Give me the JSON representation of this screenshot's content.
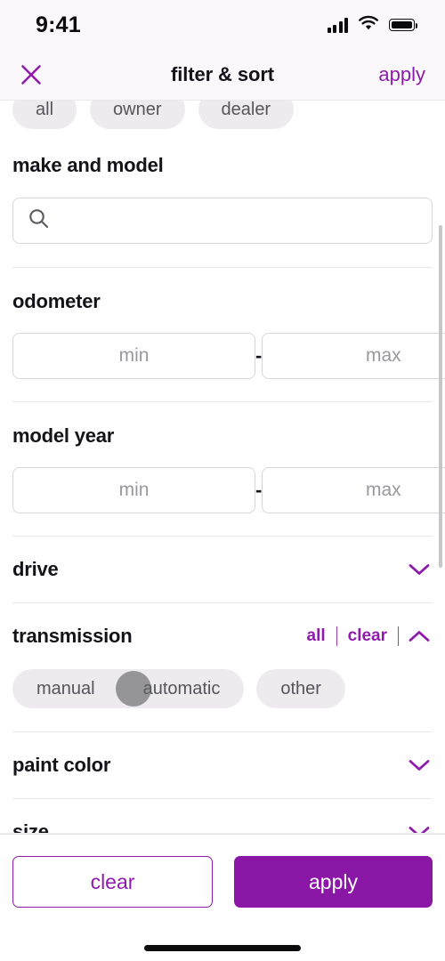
{
  "status_bar": {
    "time": "9:41",
    "cellular_icon": "signal-bars-icon",
    "wifi_icon": "wifi-icon",
    "battery_icon": "battery-full-icon"
  },
  "header": {
    "close_icon": "close-icon",
    "title": "filter & sort",
    "apply_label": "apply"
  },
  "seller_chips": [
    {
      "label": "all"
    },
    {
      "label": "owner"
    },
    {
      "label": "dealer"
    }
  ],
  "sections": {
    "make_and_model": {
      "title": "make and model",
      "search_icon": "search-icon",
      "search_value": "",
      "search_placeholder": ""
    },
    "odometer": {
      "title": "odometer",
      "min_value": "",
      "min_placeholder": "min",
      "max_value": "",
      "max_placeholder": "max",
      "separator": "-"
    },
    "model_year": {
      "title": "model year",
      "min_value": "",
      "min_placeholder": "min",
      "max_value": "",
      "max_placeholder": "max",
      "separator": "-"
    },
    "drive": {
      "title": "drive",
      "chevron_icon": "chevron-down-icon",
      "expanded": false
    },
    "transmission": {
      "title": "transmission",
      "all_label": "all",
      "clear_label": "clear",
      "chevron_icon": "chevron-up-icon",
      "expanded": true,
      "options": [
        {
          "label": "manual"
        },
        {
          "label": "automatic"
        },
        {
          "label": "other"
        }
      ]
    },
    "paint_color": {
      "title": "paint color",
      "chevron_icon": "chevron-down-icon",
      "expanded": false
    },
    "size": {
      "title": "size",
      "chevron_icon": "chevron-down-icon",
      "expanded": false
    }
  },
  "footer": {
    "clear_label": "clear",
    "apply_label": "apply"
  },
  "colors": {
    "accent_purple": "#8F1BAB",
    "apply_button": "#8B17A6",
    "chip_bg": "#EDEBEE",
    "chip_text": "#56545C",
    "header_bg": "#FAF8FB",
    "border": "#D8D5DB"
  }
}
